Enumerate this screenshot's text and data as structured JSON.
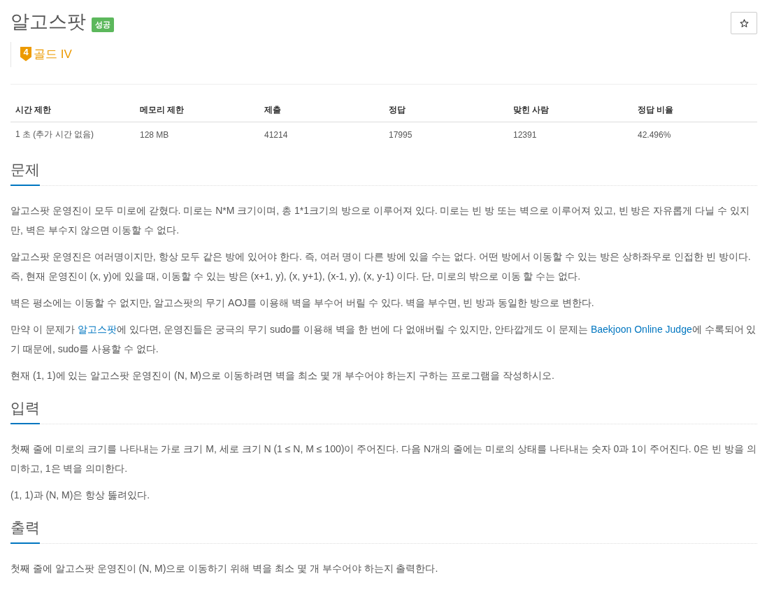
{
  "problem": {
    "title": "알고스팟",
    "result_badge": "성공",
    "favorite_button": {
      "on": false
    },
    "tier": {
      "badge": "4",
      "label": "골드 IV"
    }
  },
  "stats_table": {
    "columns": [
      "시간 제한",
      "메모리 제한",
      "제출",
      "정답",
      "맞힌 사람",
      "정답 비율"
    ],
    "rows": [
      [
        "1 초 (추가 시간 없음)",
        "128 MB",
        "41214",
        "17995",
        "12391",
        "42.496%"
      ]
    ]
  },
  "sections": [
    {
      "heading": "문제",
      "paragraphs": [
        [
          {
            "kind": "text",
            "text": "알고스팟 운영진이 모두 미로에 갇혔다. 미로는 N*M 크기이며, 총 1*1크기의 방으로 이루어져 있다. 미로는 빈 방 또는 벽으로 이루어져 있고, 빈 방은 자유롭게 다닐 수 있지만, 벽은 부수지 않으면 이동할 수 없다."
          }
        ],
        [
          {
            "kind": "text",
            "text": "알고스팟 운영진은 여러명이지만, 항상 모두 같은 방에 있어야 한다. 즉, 여러 명이 다른 방에 있을 수는 없다. 어떤 방에서 이동할 수 있는 방은 상하좌우로 인접한 빈 방이다. 즉, 현재 운영진이 (x, y)에 있을 때, 이동할 수 있는 방은 (x+1, y), (x, y+1), (x-1, y), (x, y-1) 이다. 단, 미로의 밖으로 이동 할 수는 없다."
          }
        ],
        [
          {
            "kind": "text",
            "text": "벽은 평소에는 이동할 수 없지만, 알고스팟의 무기 AOJ를 이용해 벽을 부수어 버릴 수 있다. 벽을 부수면, 빈 방과 동일한 방으로 변한다."
          }
        ],
        [
          {
            "kind": "text",
            "text": "만약 이 문제가 "
          },
          {
            "kind": "link",
            "text": "알고스팟"
          },
          {
            "kind": "text",
            "text": "에 있다면, 운영진들은 궁극의 무기 sudo를 이용해 벽을 한 번에 다 없애버릴 수 있지만, 안타깝게도 이 문제는 "
          },
          {
            "kind": "link",
            "text": "Baekjoon Online Judge"
          },
          {
            "kind": "text",
            "text": "에 수록되어 있기 때문에, sudo를 사용할 수 없다."
          }
        ],
        [
          {
            "kind": "text",
            "text": "현재 (1, 1)에 있는 알고스팟 운영진이 (N, M)으로 이동하려면 벽을 최소 몇 개 부수어야 하는지 구하는 프로그램을 작성하시오."
          }
        ]
      ]
    },
    {
      "heading": "입력",
      "paragraphs": [
        [
          {
            "kind": "text",
            "text": "첫째 줄에 미로의 크기를 나타내는 가로 크기 M, 세로 크기 N (1 ≤ N, M ≤ 100)이 주어진다. 다음 N개의 줄에는 미로의 상태를 나타내는 숫자 0과 1이 주어진다. 0은 빈 방을 의미하고, 1은 벽을 의미한다."
          }
        ],
        [
          {
            "kind": "text",
            "text": "(1, 1)과 (N, M)은 항상 뚫려있다."
          }
        ]
      ]
    },
    {
      "heading": "출력",
      "paragraphs": [
        [
          {
            "kind": "text",
            "text": "첫째 줄에 알고스팟 운영진이 (N, M)으로 이동하기 위해 벽을 최소 몇 개 부수어야 하는지 출력한다."
          }
        ]
      ]
    }
  ]
}
